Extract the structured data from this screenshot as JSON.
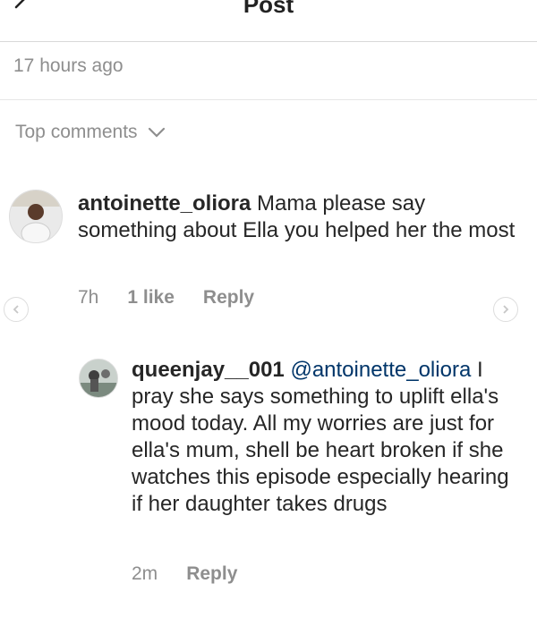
{
  "header": {
    "title": "Post",
    "back_icon": "chevron-left-icon"
  },
  "post": {
    "timestamp": "17 hours ago"
  },
  "comments_section": {
    "label": "Top comments",
    "dropdown_icon": "chevron-down-icon"
  },
  "comments": [
    {
      "username": "antoinette_oliora",
      "text": "Mama please say something about Ella you helped her the most",
      "time": "7h",
      "likes": "1 like",
      "reply_label": "Reply"
    }
  ],
  "replies": [
    {
      "username": "queenjay__001",
      "mention": "@antoinette_oliora",
      "text": "I pray she says something to uplift ella's mood today. All my worries are just for ella's mum, shell be heart broken if she watches this episode especially hearing if her daughter takes drugs",
      "time": "2m",
      "reply_label": "Reply"
    }
  ],
  "colors": {
    "text": "#262626",
    "secondary": "#8e8e8e",
    "mention": "#003569",
    "divider": "#e6e6e6"
  }
}
